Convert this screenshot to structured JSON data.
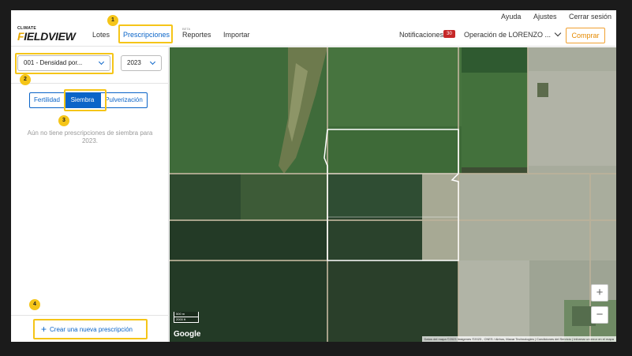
{
  "utility_links": [
    "Ayuda",
    "Ajustes",
    "Cerrar sesión"
  ],
  "logo": {
    "small": "CLIMATE",
    "big": "FIELDVIEW"
  },
  "nav": {
    "lotes": "Lotes",
    "prescripciones": "Prescripciones",
    "beta": "BETA",
    "reportes": "Reportes",
    "importar": "Importar"
  },
  "notifications": {
    "label": "Notificaciones",
    "count": "30"
  },
  "operation": {
    "label": "Operación de LORENZO ..."
  },
  "buy_button": "Comprar",
  "sidebar": {
    "prescription_select": "001 - Densidad por...",
    "year_select": "2023",
    "tabs": [
      "Fertilidad",
      "Siembra",
      "Pulverización"
    ],
    "active_tab": "Siembra",
    "empty_message": "Aún no tiene prescripciones de siembra para 2023.",
    "create_button": "Crear una nueva prescripción"
  },
  "markers": [
    "1",
    "2",
    "3",
    "4"
  ],
  "map": {
    "provider": "Google",
    "attribution": "Datos del mapa ©2023 Imágenes ©2023 , CNES / Airbus, Maxar Technologies | Condiciones del Servicio | Informar un error en el mapa",
    "scale_top": "500 m",
    "scale_bottom": "2000 ft",
    "zoom_in": "+",
    "zoom_out": "−"
  },
  "colors": {
    "accent_blue": "#0a64c8",
    "highlight": "#f5c518",
    "buy_orange": "#e68a00",
    "badge_red": "#c62828"
  }
}
